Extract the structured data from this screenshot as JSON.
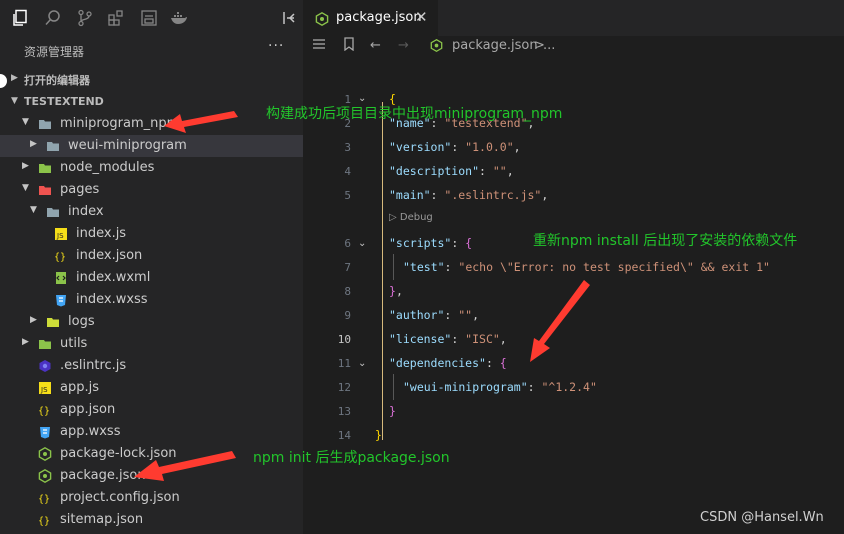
{
  "activity_icons": [
    "explorer-icon",
    "search-icon",
    "source-control-icon",
    "extensions-icon",
    "outline-icon",
    "docker-icon",
    "split-sidebar-icon"
  ],
  "sidebar": {
    "title": "资源管理器",
    "more": "···",
    "open_editors": "打开的编辑器",
    "project": "TESTEXTEND"
  },
  "tree": [
    {
      "label": "miniprogram_npm",
      "icon": "folder-icon",
      "twisty": "▼"
    },
    {
      "label": "weui-miniprogram",
      "icon": "folder-icon",
      "twisty": "▶"
    },
    {
      "label": "node_modules",
      "icon": "folder-node-icon",
      "twisty": "▶"
    },
    {
      "label": "pages",
      "icon": "folder-pages-icon",
      "twisty": "▼"
    },
    {
      "label": "index",
      "icon": "folder-icon",
      "twisty": "▼"
    },
    {
      "label": "index.js",
      "icon": "js-file-icon",
      "twisty": ""
    },
    {
      "label": "index.json",
      "icon": "json-file-icon",
      "twisty": ""
    },
    {
      "label": "index.wxml",
      "icon": "wxml-file-icon",
      "twisty": ""
    },
    {
      "label": "index.wxss",
      "icon": "wxss-file-icon",
      "twisty": ""
    },
    {
      "label": "logs",
      "icon": "folder-logs-icon",
      "twisty": "▶"
    },
    {
      "label": "utils",
      "icon": "folder-utils-icon",
      "twisty": "▶"
    },
    {
      "label": ".eslintrc.js",
      "icon": "eslint-file-icon",
      "twisty": ""
    },
    {
      "label": "app.js",
      "icon": "js-file-icon",
      "twisty": ""
    },
    {
      "label": "app.json",
      "icon": "json-file-icon",
      "twisty": ""
    },
    {
      "label": "app.wxss",
      "icon": "wxss-file-icon",
      "twisty": ""
    },
    {
      "label": "package-lock.json",
      "icon": "npm-file-icon",
      "twisty": ""
    },
    {
      "label": "package.json",
      "icon": "npm-file-icon",
      "twisty": ""
    },
    {
      "label": "project.config.json",
      "icon": "json-file-icon",
      "twisty": ""
    },
    {
      "label": "sitemap.json",
      "icon": "json-file-icon",
      "twisty": ""
    }
  ],
  "tab": {
    "label": "package.json",
    "close": "✕"
  },
  "breadcrumb": {
    "file": "package.json",
    "sep": ">",
    "rest": "..."
  },
  "code_lens": "▷ Debug",
  "gutter": [
    "1",
    "2",
    "3",
    "4",
    "5",
    "6",
    "7",
    "8",
    "9",
    "10",
    "11",
    "12",
    "13",
    "14"
  ],
  "code": {
    "l1": "{",
    "name_k": "\"name\"",
    "name_v": "\"testextend\"",
    "version_k": "\"version\"",
    "version_v": "\"1.0.0\"",
    "desc_k": "\"description\"",
    "desc_v": "\"\"",
    "main_k": "\"main\"",
    "main_v": "\".eslintrc.js\"",
    "scripts_k": "\"scripts\"",
    "test_k": "\"test\"",
    "test_v": "\"echo \\\"Error: no test specified\\\" && exit 1\"",
    "author_k": "\"author\"",
    "author_v": "\"\"",
    "license_k": "\"license\"",
    "license_v": "\"ISC\"",
    "deps_k": "\"dependencies\"",
    "weui_k": "\"weui-miniprogram\"",
    "weui_v": "\"^1.2.4\"",
    "close_brace": "}"
  },
  "annotations": {
    "top": "构建成功后项目目录中出现miniprogram_npm",
    "middle": "重新npm install 后出现了安装的依赖文件",
    "bottom": "npm init 后生成package.json"
  },
  "watermark": "CSDN @Hansel.Wn",
  "colors": {
    "annotation": "#22c52b",
    "arrow": "#ff3b30"
  }
}
